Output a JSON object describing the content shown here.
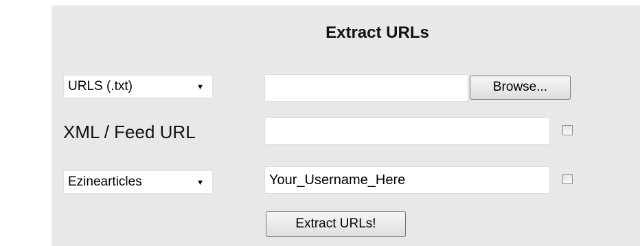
{
  "form": {
    "title": "Extract URLs",
    "row1": {
      "select_value": "URLS (.txt)",
      "file_value": "",
      "browse_label": "Browse..."
    },
    "row2": {
      "label": "XML / Feed URL",
      "url_value": "",
      "checkbox_checked": false
    },
    "row3": {
      "select_value": "Ezinearticles",
      "username_value": "Your_Username_Here",
      "checkbox_checked": false
    },
    "submit_label": "Extract URLs!"
  }
}
